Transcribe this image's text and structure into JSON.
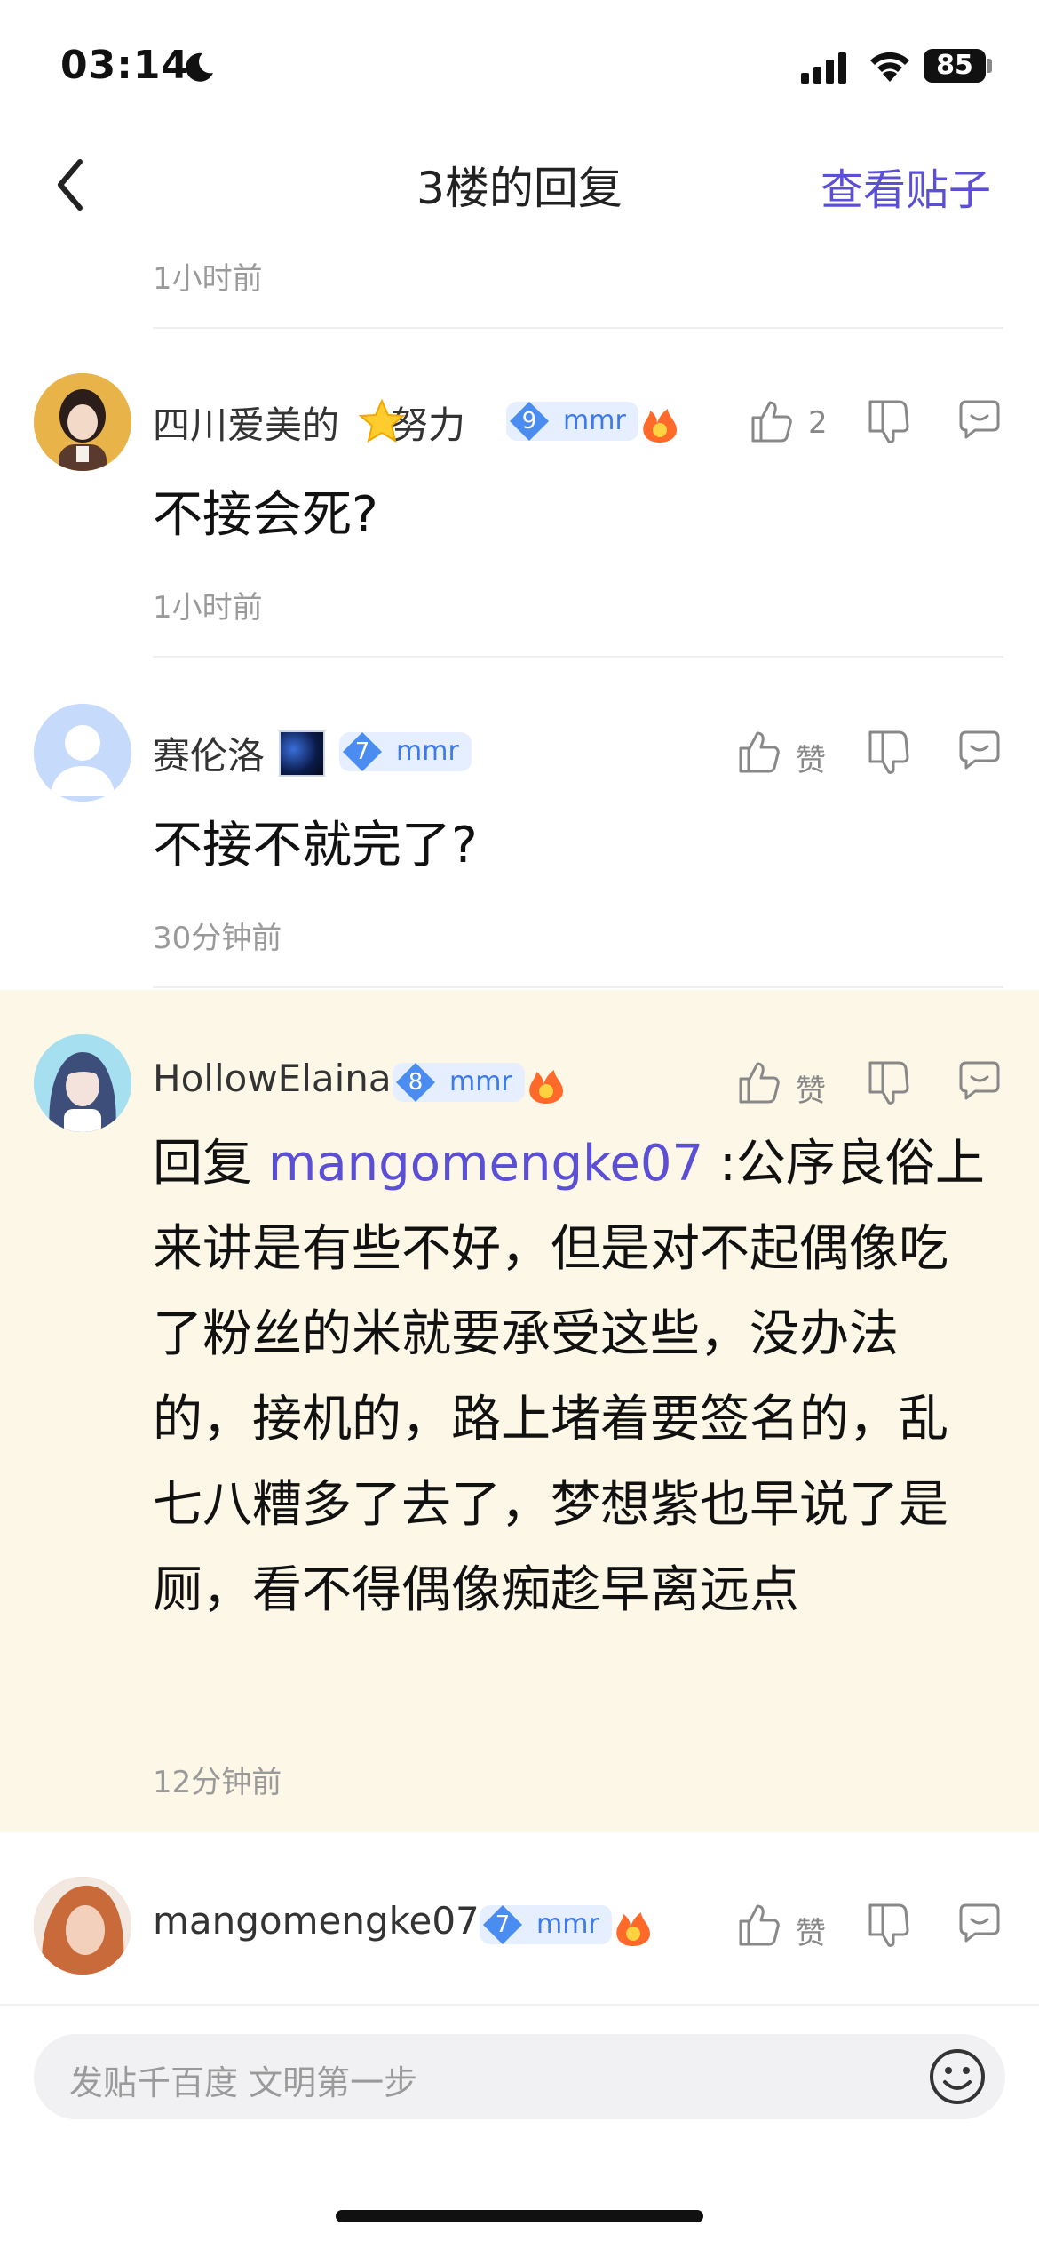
{
  "status_bar": {
    "time": "03:14",
    "battery": "85"
  },
  "nav": {
    "title": "3楼的回复",
    "action": "查看贴子"
  },
  "top_time": "1小时前",
  "comments": [
    {
      "username": "四川爱美的",
      "username_suffix": "努力",
      "level": "9",
      "badge": "mmr",
      "likes": "2",
      "content": "不接会死?",
      "time": "1小时前"
    },
    {
      "username": "赛伦洛",
      "level": "7",
      "badge": "mmr",
      "likes": "赞",
      "content": "不接不就完了?",
      "time": "30分钟前"
    },
    {
      "username": "HollowElaina",
      "level": "8",
      "badge": "mmr",
      "likes": "赞",
      "reply_prefix": "回复 ",
      "mention": "mangomengke07",
      "content": " :公序良俗上来讲是有些不好，但是对不起偶像吃了粉丝的米就要承受这些，没办法的，接机的，路上堵着要签名的，乱七八糟多了去了，梦想紫也早说了是厕，看不得偶像痴趁早离远点",
      "time": "12分钟前"
    },
    {
      "username": "mangomengke07",
      "level": "7",
      "badge": "mmr",
      "likes": "赞"
    }
  ],
  "input": {
    "placeholder": "发贴千百度 文明第一步"
  },
  "colors": {
    "accent": "#5b4fd6",
    "highlight_bg": "#fcf7e6",
    "badge_bg": "#e5efff",
    "badge_text": "#3f7be8"
  }
}
